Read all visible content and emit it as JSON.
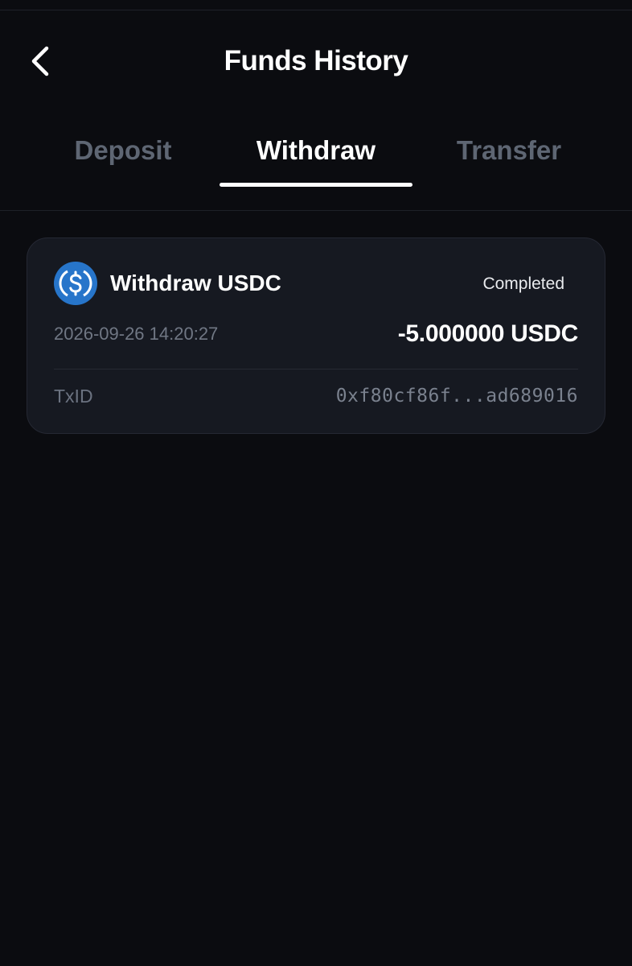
{
  "header": {
    "title": "Funds History",
    "back_icon": "chevron-left-icon"
  },
  "tabs": [
    {
      "label": "Deposit",
      "active": false
    },
    {
      "label": "Withdraw",
      "active": true
    },
    {
      "label": "Transfer",
      "active": false
    }
  ],
  "records": [
    {
      "icon": "usdc-coin-icon",
      "title": "Withdraw USDC",
      "status": "Completed",
      "timestamp": "2026-09-26 14:20:27",
      "amount": "-5.000000 USDC",
      "txid_label": "TxID",
      "txid_value": "0xf80cf86f...ad689016"
    }
  ],
  "colors": {
    "background": "#0b0c10",
    "card": "#161921",
    "usdc_blue": "#2775ca",
    "muted_text": "#5e6673"
  }
}
